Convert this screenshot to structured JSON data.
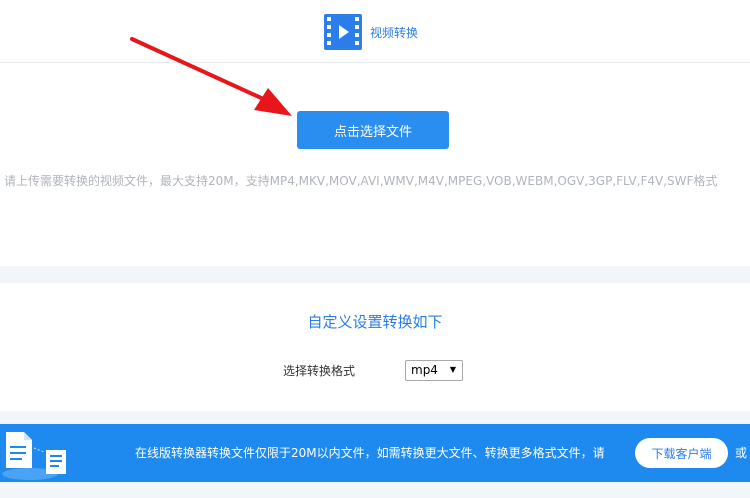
{
  "tab": {
    "label": "视频转换",
    "icon": "video-icon"
  },
  "upload": {
    "button_label": "点击选择文件",
    "hint": "请上传需要转换的视频文件，最大支持20M，支持MP4,MKV,MOV,AVI,WMV,M4V,MPEG,VOB,WEBM,OGV,3GP,FLV,F4V,SWF格式"
  },
  "settings": {
    "title": "自定义设置转换如下",
    "format_label": "选择转换格式",
    "format_value": "mp4"
  },
  "banner": {
    "text": "在线版转换器转换文件仅限于20M以内文件，如需转换更大文件、转换更多格式文件，请",
    "download_label": "下载客户端",
    "or_text": "或"
  },
  "colors": {
    "accent": "#2a8df0",
    "banner": "#1e8af0",
    "arrow": "#e8161b"
  }
}
